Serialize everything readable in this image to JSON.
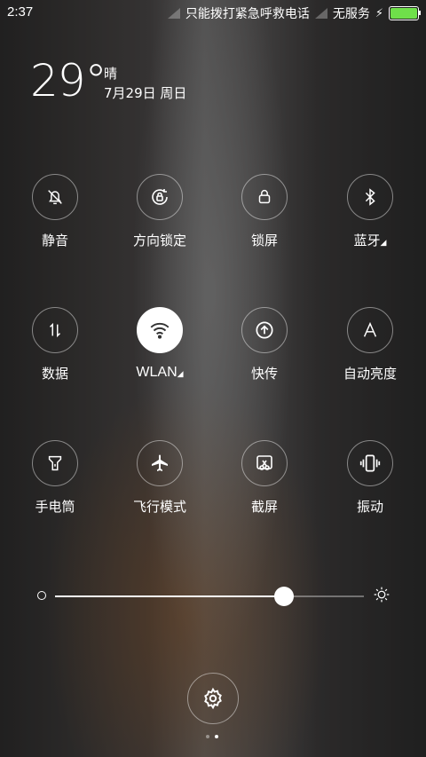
{
  "status_bar": {
    "time": "2:37",
    "sim1_text": "只能拨打紧急呼救电话",
    "sim2_text": "无服务",
    "battery_level": 1.0,
    "battery_color": "#6fe04a"
  },
  "weather": {
    "temperature": "29°",
    "condition": "晴",
    "date": "7月29日 周日"
  },
  "toggles": [
    {
      "label": "静音",
      "icon": "bell-off-icon",
      "active": false
    },
    {
      "label": "方向锁定",
      "icon": "rotation-lock-icon",
      "active": false
    },
    {
      "label": "锁屏",
      "icon": "lock-icon",
      "active": false
    },
    {
      "label": "蓝牙",
      "icon": "bluetooth-icon",
      "active": false,
      "has_submenu": true
    },
    {
      "label": "数据",
      "icon": "data-arrows-icon",
      "active": false
    },
    {
      "label": "WLAN",
      "icon": "wifi-icon",
      "active": true,
      "has_submenu": true
    },
    {
      "label": "快传",
      "icon": "upload-icon",
      "active": false
    },
    {
      "label": "自动亮度",
      "icon": "auto-brightness-icon",
      "active": false
    },
    {
      "label": "手电筒",
      "icon": "flashlight-icon",
      "active": false
    },
    {
      "label": "飞行模式",
      "icon": "airplane-icon",
      "active": false
    },
    {
      "label": "截屏",
      "icon": "screenshot-icon",
      "active": false
    },
    {
      "label": "振动",
      "icon": "vibrate-icon",
      "active": false
    }
  ],
  "brightness": {
    "level": 0.74
  },
  "page_indicator": {
    "count": 2,
    "active_index": 1
  }
}
